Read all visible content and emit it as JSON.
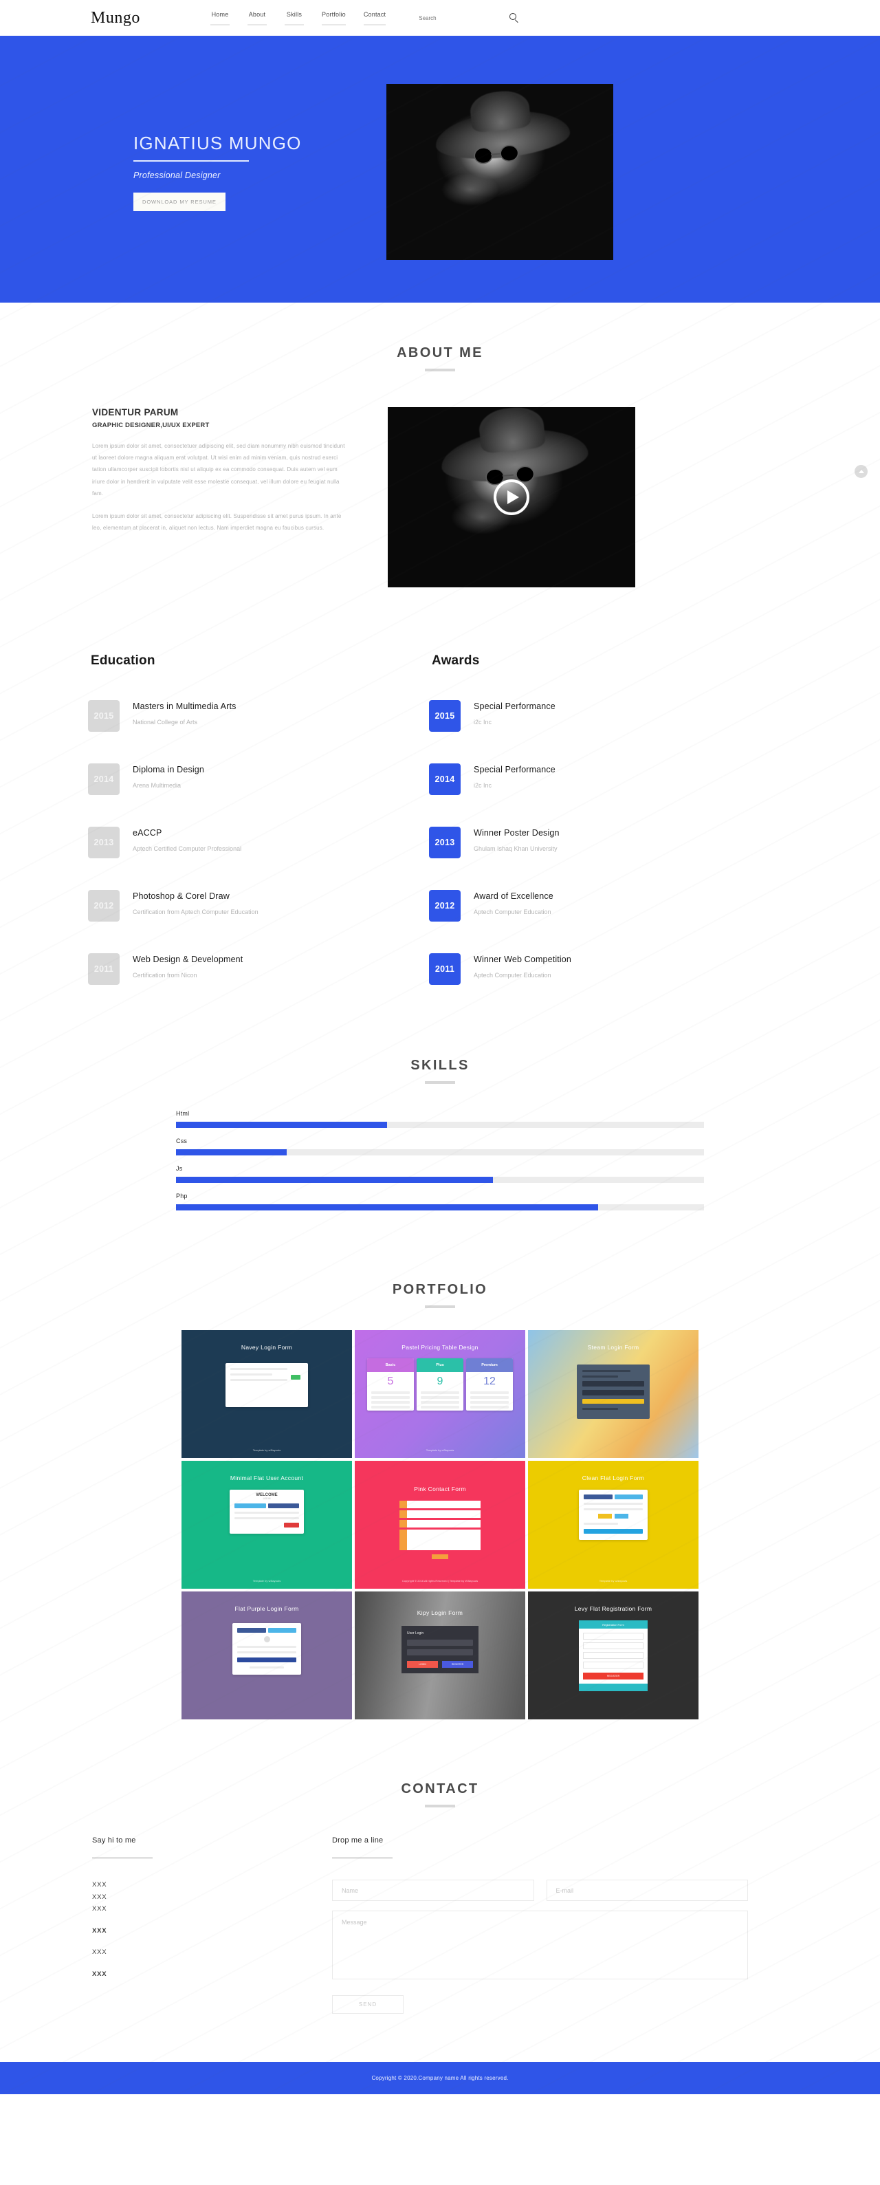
{
  "nav": {
    "brand": "Mungo",
    "links": [
      "Home",
      "About",
      "Skills",
      "Portfolio",
      "Contact"
    ],
    "search_placeholder": "Search",
    "search_icon": "search-icon"
  },
  "hero": {
    "name": "IGNATIUS MUNGO",
    "role": "Professional Designer",
    "button": "DOWNLOAD MY RESUME",
    "bg_color": "#2f55e8"
  },
  "about": {
    "title": "ABOUT ME",
    "heading": "VIDENTUR PARUM",
    "subheading": "GRAPHIC DESIGNER,UI/UX EXPERT",
    "paragraph1": "Lorem ipsum dolor sit amet, consectetuer adipiscing elit, sed diam nonummy nibh euismod tincidunt ut laoreet dolore magna aliquam erat volutpat. Ut wisi enim ad minim veniam, quis nostrud exerci tation ullamcorper suscipit lobortis nisl ut aliquip ex ea commodo consequat. Duis autem vel eum iriure dolor in hendrerit in vulputate velit esse molestie consequat, vel illum dolore eu feugiat nulla fam.",
    "paragraph2": "Lorem ipsum dolor sit amet, consectetur adipiscing elit. Suspendisse sit amet purus ipsum. In ante leo, elementum at placerat in, aliquet non lectus. Nam imperdiet magna eu faucibus cursus.",
    "play_icon": "play-icon"
  },
  "education": {
    "heading": "Education",
    "items": [
      {
        "year": "2015",
        "title": "Masters in Multimedia Arts",
        "sub": "National College of Arts"
      },
      {
        "year": "2014",
        "title": "Diploma in Design",
        "sub": "Arena Multimedia"
      },
      {
        "year": "2013",
        "title": "eACCP",
        "sub": "Aptech Certified Computer Professional"
      },
      {
        "year": "2012",
        "title": "Photoshop & Corel Draw",
        "sub": "Certification from Aptech Computer Education"
      },
      {
        "year": "2011",
        "title": "Web Design & Development",
        "sub": "Certification from Nicon"
      }
    ]
  },
  "awards": {
    "heading": "Awards",
    "items": [
      {
        "year": "2015",
        "title": "Special Performance",
        "sub": "i2c Inc"
      },
      {
        "year": "2014",
        "title": "Special Performance",
        "sub": "i2c Inc"
      },
      {
        "year": "2013",
        "title": "Winner Poster Design",
        "sub": "Ghulam Ishaq Khan University"
      },
      {
        "year": "2012",
        "title": "Award of Excellence",
        "sub": "Aptech Computer Education"
      },
      {
        "year": "2011",
        "title": "Winner Web Competition",
        "sub": "Aptech Computer Education"
      }
    ]
  },
  "skills": {
    "title": "SKILLS",
    "accent_color": "#2f55e8",
    "track_color": "#ececec",
    "items": [
      {
        "label": "Html",
        "percent": 40
      },
      {
        "label": "Css",
        "percent": 21
      },
      {
        "label": "Js",
        "percent": 60
      },
      {
        "label": "Php",
        "percent": 80
      }
    ]
  },
  "portfolio": {
    "title": "PORTFOLIO",
    "tiles": [
      {
        "label": "Navey Login Form",
        "footer": "Template by w3layouts"
      },
      {
        "label": "Pastel Pricing Table Design",
        "footer": "Template by w3layouts"
      },
      {
        "label": "Steam Login Form",
        "footer": ""
      },
      {
        "label": "Minimal Flat User Account",
        "footer": "Template by w3layouts"
      },
      {
        "label": "Pink Contact Form",
        "footer": "Copyright © 2016 All rights Reserved | Template by W3layouts"
      },
      {
        "label": "Clean Flat Login Form",
        "footer": "Template by w3layouts"
      },
      {
        "label": "Flat Purple Login Form",
        "footer": ""
      },
      {
        "label": "Kipy Login Form",
        "footer": ""
      },
      {
        "label": "Levy Flat Registration Form",
        "footer": ""
      }
    ],
    "pricing": {
      "plans": [
        "Basic",
        "Plus",
        "Premium"
      ],
      "prices": [
        "5",
        "9",
        "12"
      ]
    },
    "minimal_account": {
      "welcome": "WELCOME",
      "sub": "LOG IN",
      "login_btn": "Log in"
    },
    "kipy": {
      "heading": "User Login",
      "login_btn": "LOGIN",
      "register_btn": "REGISTER"
    },
    "levy": {
      "form_head": "Registration Form",
      "submit": "REGISTER"
    }
  },
  "contact": {
    "title": "CONTACT",
    "left_heading": "Say hi to me",
    "left_items": [
      {
        "text": "XXX",
        "bold": false,
        "gap_after": false
      },
      {
        "text": "XXX",
        "bold": false,
        "gap_after": false
      },
      {
        "text": "XXX",
        "bold": false,
        "gap_after": true
      },
      {
        "text": "XXX",
        "bold": true,
        "gap_after": true
      },
      {
        "text": "XXX",
        "bold": false,
        "gap_after": true
      },
      {
        "text": "XXX",
        "bold": true,
        "gap_after": false
      }
    ],
    "right_heading": "Drop me a line",
    "name_placeholder": "Name",
    "email_placeholder": "E-mail",
    "message_placeholder": "Message",
    "send_label": "SEND"
  },
  "footer": {
    "text": "Copyright © 2020.Company name All rights reserved."
  },
  "scroll_top": {
    "icon": "chevron-up-icon"
  }
}
